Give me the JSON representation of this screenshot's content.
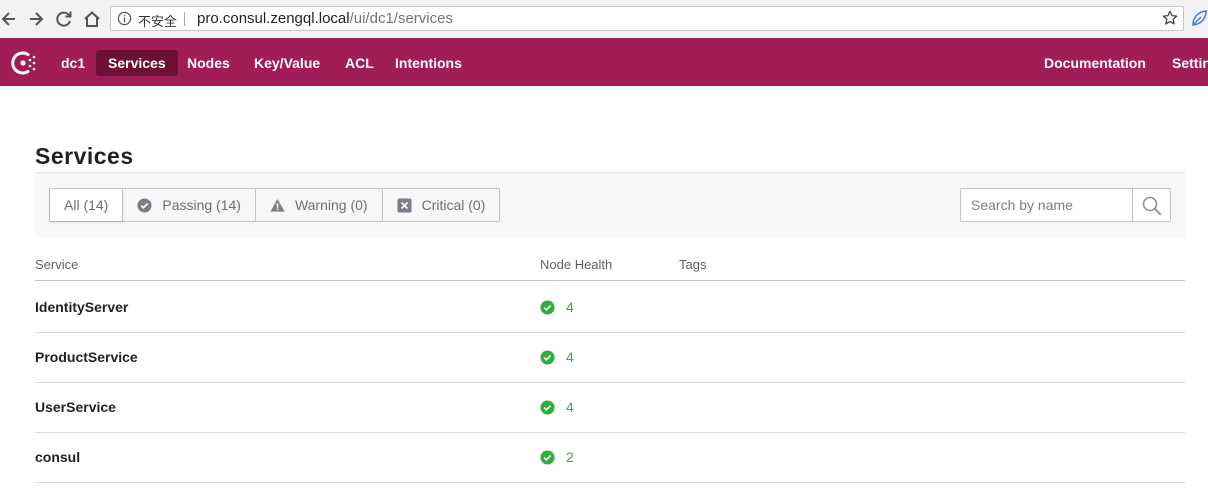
{
  "browser": {
    "security_label": "不安全",
    "url_host": "pro.consul.zengql.local",
    "url_path": "/ui/dc1/services"
  },
  "nav": {
    "datacenter": "dc1",
    "items": [
      {
        "label": "Services",
        "active": true
      },
      {
        "label": "Nodes",
        "active": false
      },
      {
        "label": "Key/Value",
        "active": false
      },
      {
        "label": "ACL",
        "active": false
      },
      {
        "label": "Intentions",
        "active": false
      }
    ],
    "right_items": [
      {
        "label": "Documentation"
      },
      {
        "label": "Settin"
      }
    ],
    "brand_color": "#a11d57"
  },
  "page": {
    "title": "Services"
  },
  "filters": [
    {
      "label": "All (14)",
      "icon": "none",
      "active": true
    },
    {
      "label": "Passing (14)",
      "icon": "check-circle-icon",
      "active": false
    },
    {
      "label": "Warning (0)",
      "icon": "warning-icon",
      "active": false
    },
    {
      "label": "Critical (0)",
      "icon": "x-square-icon",
      "active": false
    }
  ],
  "search": {
    "placeholder": "Search by name",
    "value": ""
  },
  "table": {
    "columns": [
      "Service",
      "Node Health",
      "Tags"
    ],
    "rows": [
      {
        "name": "IdentityServer",
        "health": "4",
        "tags": ""
      },
      {
        "name": "ProductService",
        "health": "4",
        "tags": ""
      },
      {
        "name": "UserService",
        "health": "4",
        "tags": ""
      },
      {
        "name": "consul",
        "health": "2",
        "tags": ""
      }
    ],
    "passing_color": "#2eb039"
  }
}
